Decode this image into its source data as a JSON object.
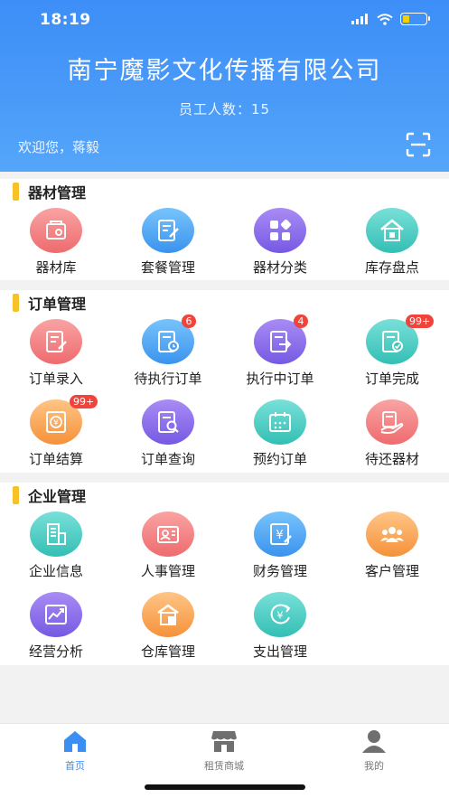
{
  "status": {
    "time": "18:19"
  },
  "header": {
    "company": "南宁魔影文化传播有限公司",
    "staff_label": "员工人数：",
    "staff_count": "15",
    "welcome": "欢迎您，蒋毅"
  },
  "sections": [
    {
      "title": "器材管理",
      "items": [
        {
          "label": "器材库",
          "icon": "equipment-icon",
          "color": "red"
        },
        {
          "label": "套餐管理",
          "icon": "package-edit-icon",
          "color": "blue"
        },
        {
          "label": "器材分类",
          "icon": "category-icon",
          "color": "purple"
        },
        {
          "label": "库存盘点",
          "icon": "inventory-home-icon",
          "color": "teal"
        }
      ]
    },
    {
      "title": "订单管理",
      "items": [
        {
          "label": "订单录入",
          "icon": "order-entry-icon",
          "color": "red"
        },
        {
          "label": "待执行订单",
          "icon": "order-pending-icon",
          "color": "blue",
          "badge": "6"
        },
        {
          "label": "执行中订单",
          "icon": "order-running-icon",
          "color": "purple",
          "badge": "4"
        },
        {
          "label": "订单完成",
          "icon": "order-done-icon",
          "color": "teal",
          "badge": "99+"
        },
        {
          "label": "订单结算",
          "icon": "order-settle-icon",
          "color": "orange",
          "badge": "99+"
        },
        {
          "label": "订单查询",
          "icon": "order-search-icon",
          "color": "purple"
        },
        {
          "label": "预约订单",
          "icon": "calendar-icon",
          "color": "teal"
        },
        {
          "label": "待还器材",
          "icon": "return-equipment-icon",
          "color": "red"
        }
      ]
    },
    {
      "title": "企业管理",
      "items": [
        {
          "label": "企业信息",
          "icon": "company-building-icon",
          "color": "teal"
        },
        {
          "label": "人事管理",
          "icon": "personnel-card-icon",
          "color": "red"
        },
        {
          "label": "财务管理",
          "icon": "finance-yen-icon",
          "color": "blue"
        },
        {
          "label": "客户管理",
          "icon": "customers-icon",
          "color": "orange"
        },
        {
          "label": "经营分析",
          "icon": "analysis-chart-icon",
          "color": "purple"
        },
        {
          "label": "仓库管理",
          "icon": "warehouse-icon",
          "color": "orange"
        },
        {
          "label": "支出管理",
          "icon": "expense-yen-icon",
          "color": "teal"
        }
      ]
    }
  ],
  "tabbar": [
    {
      "label": "首页",
      "icon": "home-icon",
      "active": true
    },
    {
      "label": "租赁商城",
      "icon": "shop-icon",
      "active": false
    },
    {
      "label": "我的",
      "icon": "user-icon",
      "active": false
    }
  ],
  "colors": {
    "accent": "#3b8ef2",
    "section_bar": "#f7c12a",
    "badge": "#f0433b"
  }
}
